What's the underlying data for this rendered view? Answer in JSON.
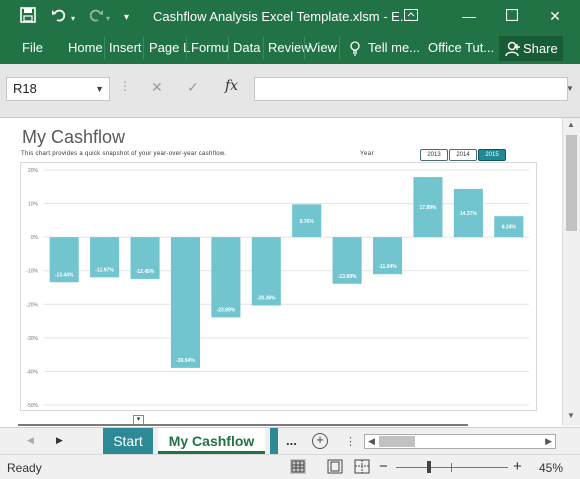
{
  "titlebar": {
    "title": "Cashflow Analysis Excel Template.xlsm - E...",
    "bg_color": "#217346"
  },
  "ribbon": {
    "tabs": [
      "File",
      "Home",
      "Insert",
      "Page L",
      "Formu",
      "Data",
      "Review",
      "View"
    ],
    "tell_me": "Tell me...",
    "office_tut": "Office Tut...",
    "share": "Share"
  },
  "formula_bar": {
    "name_box": "R18",
    "fx": "fx",
    "formula": ""
  },
  "sheet": {
    "heading": "My Cashflow",
    "subtext": "This chart provides a quick snapshot of your year-over-year cashflow.",
    "year_label": "Year",
    "years": [
      {
        "label": "2013",
        "selected": false
      },
      {
        "label": "2014",
        "selected": false
      },
      {
        "label": "2015",
        "selected": true
      }
    ],
    "filter_icon": "dropdown-filter-icon"
  },
  "chart_data": {
    "type": "bar",
    "title": "",
    "xlabel": "",
    "ylabel": "",
    "ylim": [
      -50,
      20
    ],
    "ytick_labels": [
      "20%",
      "10%",
      "0%",
      "-10%",
      "-20%",
      "-30%",
      "-40%",
      "-50%"
    ],
    "values": [
      -13.44,
      -11.97,
      -12.45,
      -38.94,
      -23.89,
      -20.36,
      9.76,
      -13.89,
      -11.04,
      17.89,
      14.37,
      6.24
    ],
    "data_labels": [
      "-13.44%",
      "-11.97%",
      "-12.45%",
      "-38.94%",
      "-23.89%",
      "-20.36%",
      "9.76%",
      "-13.89%",
      "-11.04%",
      "17.89%",
      "14.37%",
      "6.24%"
    ],
    "color": "#72c5cf",
    "grid": true
  },
  "sheet_tabs": {
    "tabs": [
      {
        "label": "Start",
        "active": false,
        "color": "#2b8a96"
      },
      {
        "label": "My Cashflow",
        "active": true
      }
    ],
    "more": "..."
  },
  "status": {
    "ready": "Ready",
    "zoom": "45%"
  }
}
